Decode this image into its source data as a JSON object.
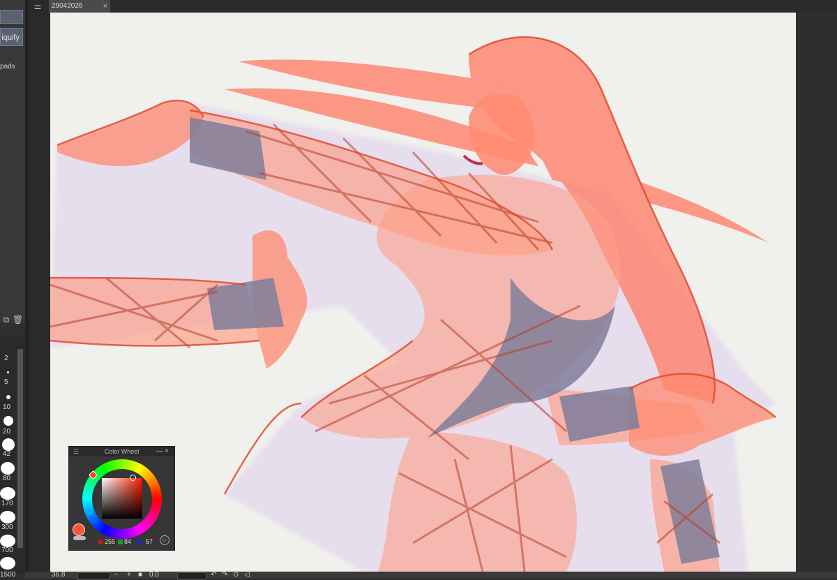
{
  "document_tab": {
    "title": "29042026",
    "close": "×"
  },
  "left_panel": {
    "liquify_label": "iquify",
    "pads_label": "pads",
    "layer_icons": [
      "copy-layer-icon",
      "trash-icon"
    ]
  },
  "brush_sizes": [
    "2",
    "5",
    "10",
    "20",
    "42",
    "80",
    "170",
    "300",
    "700",
    "1500"
  ],
  "bottom_bar": {
    "zoom": "36.8",
    "minus": "−",
    "plus": "+",
    "angle": "0.0"
  },
  "color_wheel": {
    "title": "Color Wheel",
    "menu": "☰",
    "minimize": "—",
    "close": "×",
    "r": "255",
    "g": "84",
    "b": "57",
    "main_color": "#ff5439"
  },
  "colors": {
    "canvas_bg": "#f0f0ec",
    "ui_dark": "#2b2b2b",
    "sketch_red": "#ff4a2e"
  }
}
